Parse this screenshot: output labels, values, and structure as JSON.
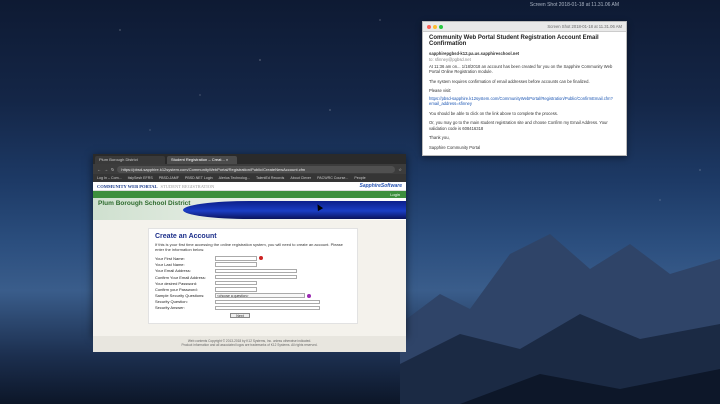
{
  "menubar": {
    "items": [
      "Screen Shot 2018-01-18 at 11.31.06 AM"
    ]
  },
  "mail": {
    "timestamp": "Screen Shot 2018-01-18 at 11.31.06 AM",
    "subject": "Community Web Portal Student Registration Account Email Confirmation",
    "from": "sapphirepgbsd-k12.pa.us.sapphireschool.net",
    "to": "to: sfinney@pgbsd.net",
    "body1": "At 11:36 am on... 1/18/2018 an account has been created for you on the Sapphire Community Web Portal Online Registration module.",
    "body2": "The system requires confirmation of email addresses before accounts can be finalized.",
    "visit_label": "Please visit:",
    "link": "https://pbsd-sapphire.k12system.com/CommunityWebPortal/Registration/Public/ConfirmEmail.cfm?email_address=sfinney",
    "body3": "You should be able to click on the link above to complete the process.",
    "body4": "Or, you may go to the main student registration site and choose Confirm my Email Address.  Your validation code is 608416318",
    "thanks": "Thank you,",
    "sign": "Sapphire Community Portal"
  },
  "browser": {
    "tabs": [
      "Plum Borough District",
      "Student Registration – Creat... ×"
    ],
    "url": "https://pbsd-sapphire.k12system.com/CommunityWebPortal/Registration/Public/CreateNewAccount.cfm",
    "bookmarks": [
      "Log In – Com...",
      "ItslySesh EFRS",
      "PBSD.JAMF",
      "PBSD.NET Login",
      "Alerius Technolog...",
      "TalentEd Records",
      "About Clever",
      "PACWRC Course...",
      "People"
    ]
  },
  "site": {
    "brand": "COMMUNITY WEB PORTAL",
    "brand2": "STUDENT REGISTRATION",
    "vendor": "SapphireSoftware",
    "login": "Login",
    "district": "Plum Borough School District"
  },
  "form": {
    "title": "Create an Account",
    "intro": "If this is your first time accessing the online registration system, you will need to create an account. Please enter the information below.",
    "fields": [
      "Your First Name:",
      "Your Last Name:",
      "Your Email Address:",
      "Confirm Your Email Address:",
      "Your desired Password:",
      "Confirm your Password:",
      "Sample Security Questions:",
      "Security Question:",
      "Security Answer:"
    ],
    "select_value": "<choose a question>",
    "next": "Next"
  },
  "footer": {
    "line1": "Web contents Copyright © 2013-2018 by K12 Systems, Inc. unless otherwise indicated.",
    "line2": "Product information and all associated logos are trademarks of K12 Systems. All rights reserved."
  },
  "colors": {
    "accent": "#1c3b8a",
    "green": "#3d8f3d",
    "required": "#cc2222"
  }
}
